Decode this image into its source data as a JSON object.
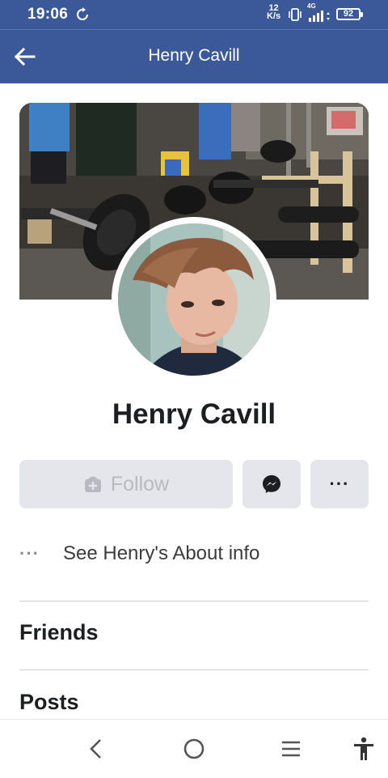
{
  "status_bar": {
    "time": "19:06",
    "net_speed_value": "12",
    "net_speed_unit": "K/s",
    "network_type": "4G",
    "battery": "92"
  },
  "app_bar": {
    "title": "Henry Cavill",
    "back_icon": "arrow-left-icon"
  },
  "profile": {
    "name": "Henry Cavill",
    "cover_description": "gym-photo",
    "avatar_description": "profile-photo"
  },
  "actions": {
    "follow_label": "Follow",
    "follow_icon": "add-friend-icon",
    "message_icon": "messenger-icon",
    "more_label": "···"
  },
  "about": {
    "dots": "···",
    "text": "See Henry's About info"
  },
  "sections": {
    "friends": "Friends",
    "posts": "Posts"
  },
  "nav_bar": {
    "icons": [
      "back-nav-icon",
      "home-nav-icon",
      "menu-nav-icon",
      "accessibility-icon"
    ]
  },
  "colors": {
    "brand": "#3b5998",
    "button_bg": "#e4e6eb",
    "disabled_text": "#b7bbc1"
  }
}
